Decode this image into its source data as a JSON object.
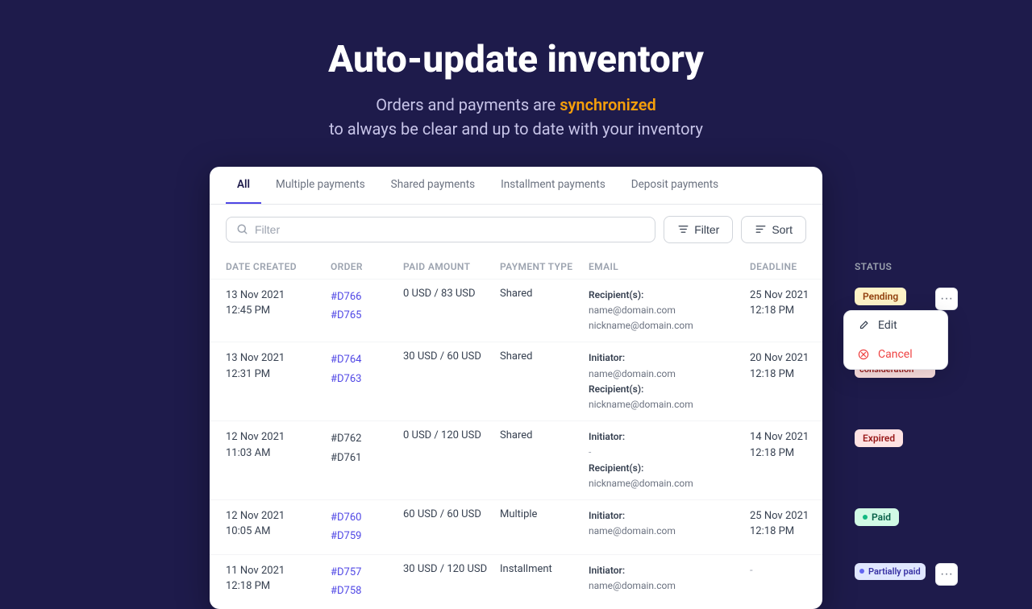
{
  "hero": {
    "title": "Auto-update inventory",
    "subtitle_line1": "Orders and payments are",
    "subtitle_highlight": "synchronized",
    "subtitle_line2": "to always be clear and up to date with your inventory"
  },
  "tabs": [
    {
      "label": "All",
      "active": true
    },
    {
      "label": "Multiple payments",
      "active": false
    },
    {
      "label": "Shared payments",
      "active": false
    },
    {
      "label": "Installment payments",
      "active": false
    },
    {
      "label": "Deposit payments",
      "active": false
    }
  ],
  "toolbar": {
    "search_placeholder": "Filter",
    "filter_label": "Filter",
    "sort_label": "Sort"
  },
  "table": {
    "headers": [
      "Date created",
      "Order",
      "Paid amount",
      "Payment type",
      "Email",
      "Deadline",
      "Status",
      ""
    ],
    "rows": [
      {
        "date": "13 Nov 2021\n12:45 PM",
        "orders": [
          "#D766",
          "#D765"
        ],
        "paid_amount": "0 USD / 83 USD",
        "payment_type": "Shared",
        "email_initiator": null,
        "email_recipients_label": "Recipient(s):",
        "email_recipients": [
          "name@domain.com",
          "nickname@domain.com"
        ],
        "deadline_date": "25 Nov 2021",
        "deadline_time": "12:18 PM",
        "status": "Pending",
        "status_type": "pending",
        "has_menu": true,
        "menu_open": true
      },
      {
        "date": "13 Nov 2021\n12:31 PM",
        "orders": [
          "#D764",
          "#D763"
        ],
        "paid_amount": "30 USD / 60 USD",
        "payment_type": "Shared",
        "email_initiator_label": "Initiator:",
        "email_initiator": "name@domain.com",
        "email_recipients_label": "Recipient(s):",
        "email_recipients": [
          "nickname@domain.com"
        ],
        "deadline_date": "20 Nov 2021",
        "deadline_time": "12:18 PM",
        "status": "Need consideration",
        "status_type": "need",
        "has_menu": false,
        "menu_open": false
      },
      {
        "date": "12 Nov 2021\n11:03 AM",
        "orders": [
          "#D762",
          "#D761"
        ],
        "paid_amount": "0 USD / 120 USD",
        "payment_type": "Shared",
        "email_initiator_label": "Initiator:",
        "email_initiator": "-",
        "email_recipients_label": "Recipient(s):",
        "email_recipients": [
          "nickname@domain.com"
        ],
        "deadline_date": "14 Nov 2021",
        "deadline_time": "12:18 PM",
        "status": "Expired",
        "status_type": "expired",
        "has_menu": false,
        "menu_open": false
      },
      {
        "date": "12 Nov 2021\n10:05 AM",
        "orders": [
          "#D760",
          "#D759"
        ],
        "paid_amount": "60 USD / 60 USD",
        "payment_type": "Multiple",
        "email_initiator_label": "Initiator:",
        "email_initiator": "name@domain.com",
        "email_recipients_label": null,
        "email_recipients": [],
        "deadline_date": "25 Nov 2021",
        "deadline_time": "12:18 PM",
        "status": "Paid",
        "status_type": "paid",
        "has_menu": false,
        "menu_open": false
      },
      {
        "date": "11 Nov 2021\n12:18 PM",
        "orders": [
          "#D757",
          "#D758"
        ],
        "paid_amount": "30 USD / 120 USD",
        "payment_type": "Installment",
        "email_initiator_label": "Initiator:",
        "email_initiator": "name@domain.com",
        "email_recipients_label": null,
        "email_recipients": [],
        "deadline_date": "-",
        "deadline_time": "",
        "status": "Partially paid",
        "status_type": "partial",
        "has_menu": true,
        "menu_open": false
      }
    ]
  },
  "context_menu": {
    "edit_label": "Edit",
    "cancel_label": "Cancel"
  },
  "colors": {
    "background": "#1e1b4b",
    "accent": "#4f46e5",
    "highlight": "#f59e0b"
  }
}
